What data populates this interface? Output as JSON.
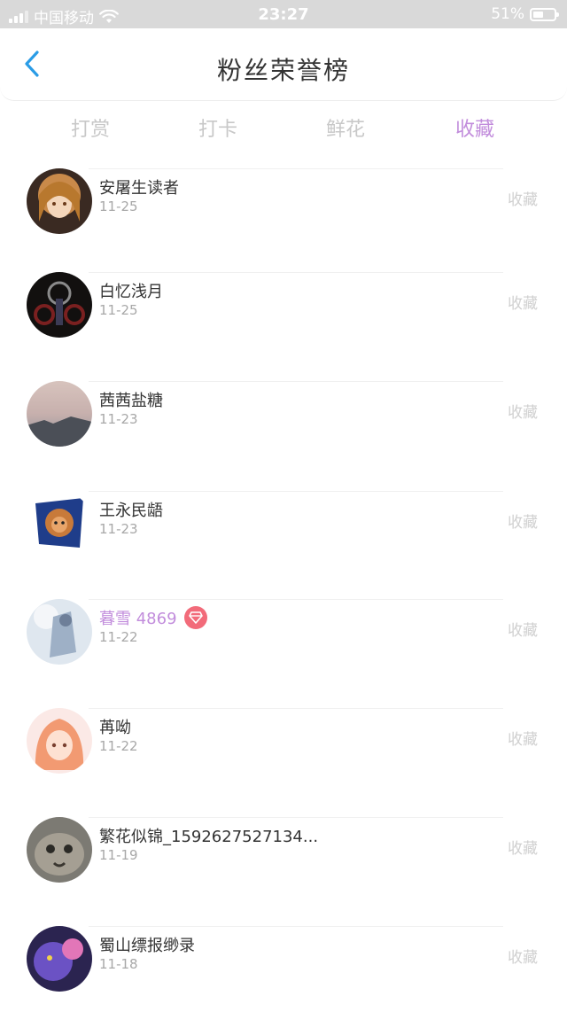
{
  "status_bar": {
    "carrier": "中国移动",
    "time": "23:27",
    "battery": "51%",
    "battery_level": 0.51
  },
  "header": {
    "title": "粉丝荣誉榜",
    "back_icon": "chevron-left-icon"
  },
  "tabs": [
    {
      "label": "打赏",
      "active": false
    },
    {
      "label": "打卡",
      "active": false
    },
    {
      "label": "鲜花",
      "active": false
    },
    {
      "label": "收藏",
      "active": true
    }
  ],
  "colors": {
    "accent": "#c28ddc",
    "inactive_tab": "#c8c8c8",
    "back_icon": "#2a9ce6",
    "gem_badge": "#f26b7a"
  },
  "fans": [
    {
      "name": "安屠生读者",
      "date": "11-25",
      "action": "收藏",
      "vip": false,
      "avatar": "anime-girl-blonde"
    },
    {
      "name": "白忆浅月",
      "date": "11-25",
      "action": "收藏",
      "vip": false,
      "avatar": "dark-gears"
    },
    {
      "name": "茜茜盐糖",
      "date": "11-23",
      "action": "收藏",
      "vip": false,
      "avatar": "sunset-sky"
    },
    {
      "name": "王永民龉",
      "date": "11-23",
      "action": "收藏",
      "vip": false,
      "avatar": "lion-emblem"
    },
    {
      "name": "暮雪 4869",
      "date": "11-22",
      "action": "收藏",
      "vip": true,
      "avatar": "winter-anime"
    },
    {
      "name": "苒呦",
      "date": "11-22",
      "action": "收藏",
      "vip": false,
      "avatar": "orange-hair-girl"
    },
    {
      "name": "繁花似锦_1592627527134...",
      "date": "11-19",
      "action": "收藏",
      "vip": false,
      "avatar": "cat-photo"
    },
    {
      "name": "蜀山缥报缈录",
      "date": "11-18",
      "action": "收藏",
      "vip": false,
      "avatar": "purple-warrior"
    }
  ]
}
